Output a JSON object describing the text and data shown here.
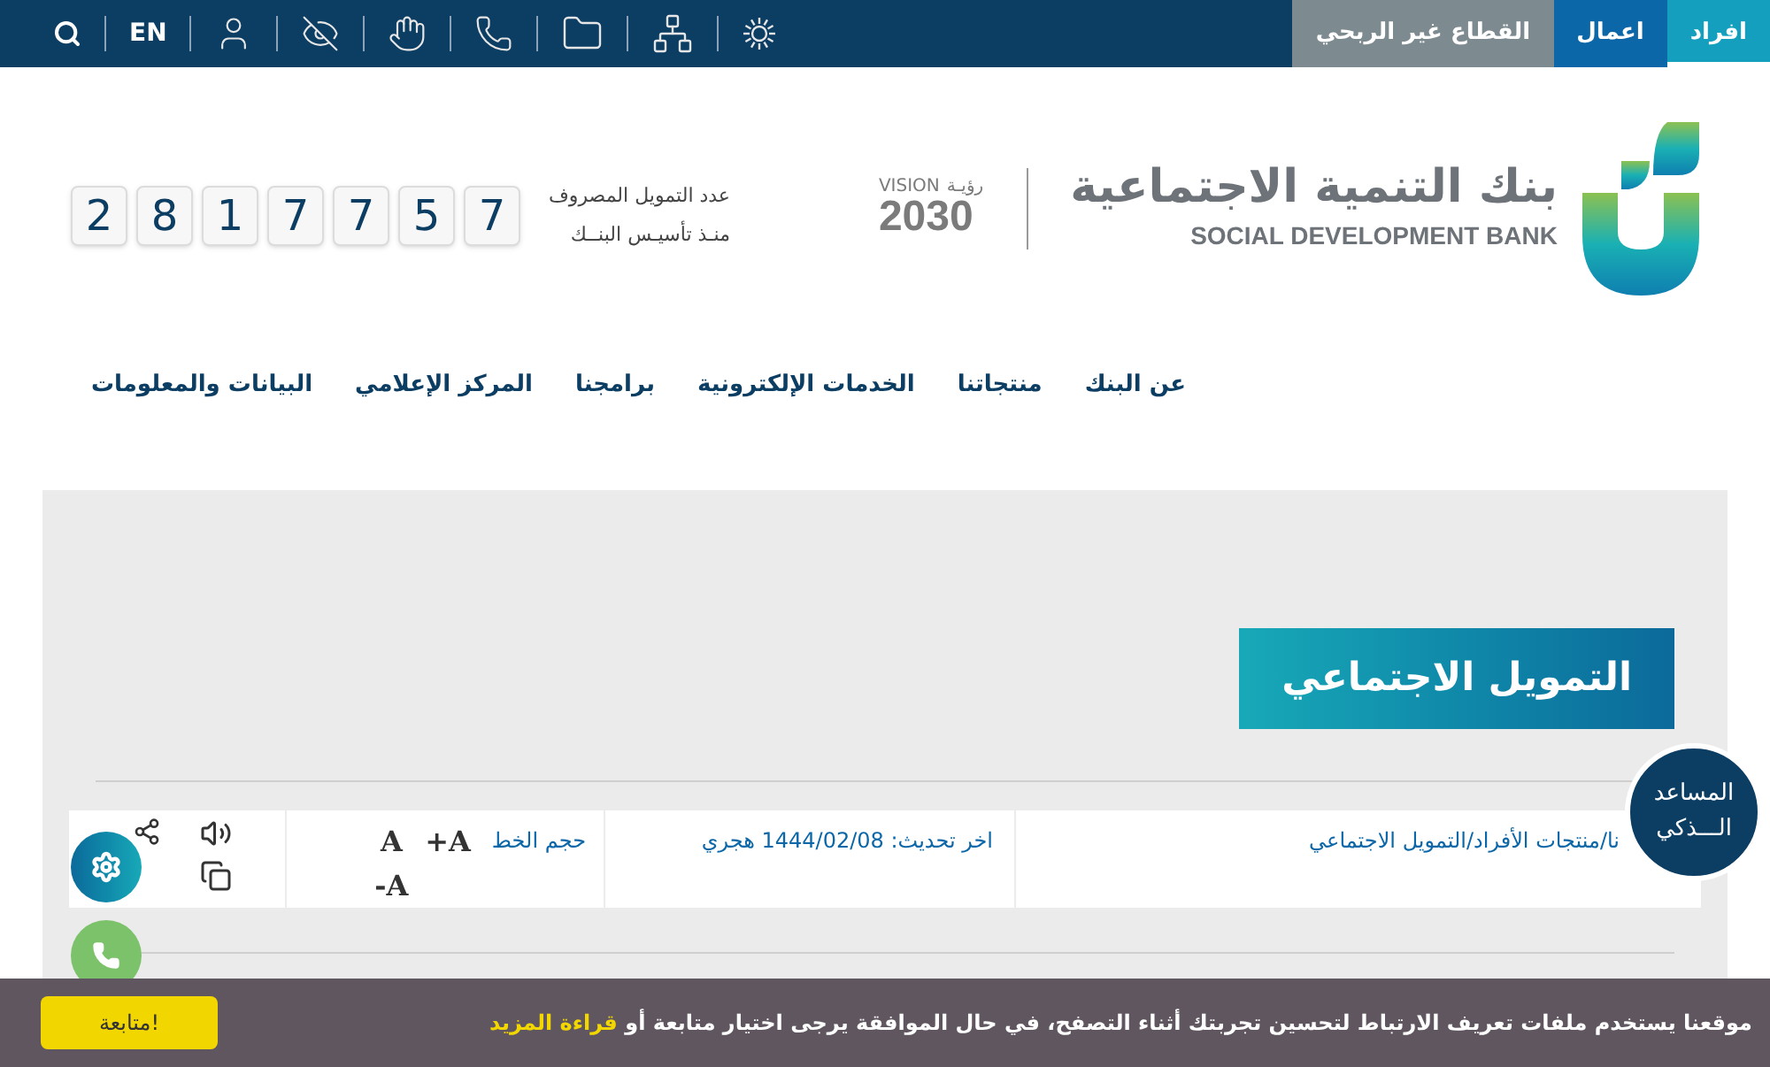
{
  "top_bar": {
    "segments": [
      {
        "label": "افراد",
        "selected": true
      },
      {
        "label": "اعمال",
        "selected": false
      },
      {
        "label": "القطاع غير الربحي",
        "selected": false
      }
    ],
    "language": "EN"
  },
  "header": {
    "logo": {
      "arabic": "بنك التنمية الاجتماعية",
      "english": "SOCIAL DEVELOPMENT BANK"
    },
    "vision": {
      "arabic": "رؤيـة",
      "label": "VISION",
      "year": "2030"
    },
    "counter": {
      "line_1": "عدد التمويل المصروف",
      "line_2": "منـذ تأسيـس البنــك",
      "digits": [
        "7",
        "5",
        "7",
        "7",
        "1",
        "8",
        "2"
      ]
    }
  },
  "nav": [
    "عن البنك",
    "منتجاتنا",
    "الخدمات الإلكترونية",
    "برامجنا",
    "المركز الإعلامي",
    "البيانات والمعلومات"
  ],
  "page": {
    "title": "التمويل الاجتماعي",
    "breadcrumb": "نا/منتجات الأفراد/التمويل الاجتماعي",
    "updated": "اخر تحديث: 1444/02/08 هجري",
    "font_size": {
      "label": "حجم الخط",
      "buttons": [
        "A",
        "+A",
        "-A"
      ]
    }
  },
  "assistant": {
    "line_1": "المساعد",
    "line_2": "الـــذكي"
  },
  "cookie_bar": {
    "text": "موقعنا يستخدم ملفات تعريف الارتباط لتحسين تجربتك أثناء التصفح، في حال الموافقة يرجى اختيار متابعة أو",
    "link": "قراءة المزيد",
    "button": "متابعة!"
  }
}
